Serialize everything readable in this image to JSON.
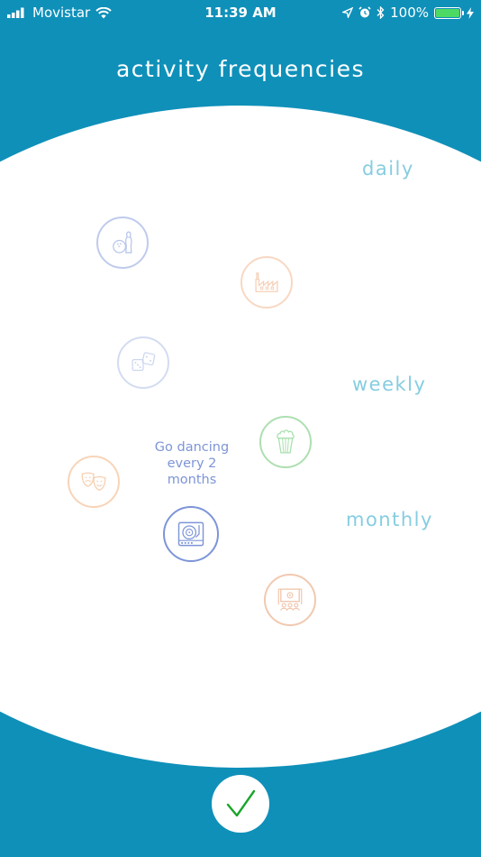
{
  "status_bar": {
    "carrier": "Movistar",
    "time": "11:39 AM",
    "battery_percent": "100%",
    "battery_level": 1.0
  },
  "title": "activity frequencies",
  "frequency_labels": {
    "daily": "daily",
    "weekly": "weekly",
    "monthly": "monthly"
  },
  "activities": [
    {
      "name": "bowling",
      "icon": "bowling-icon",
      "color": "#b8c6ea"
    },
    {
      "name": "factory",
      "icon": "factory-icon",
      "color": "#f6d0b8"
    },
    {
      "name": "dice",
      "icon": "dice-icon",
      "color": "#cdd7ef"
    },
    {
      "name": "popcorn",
      "icon": "popcorn-icon",
      "color": "#a9e1ae"
    },
    {
      "name": "theater",
      "icon": "theater-masks-icon",
      "color": "#f7cfae"
    },
    {
      "name": "dancing",
      "icon": "turntable-icon",
      "color": "#7d95d8",
      "selected": true
    },
    {
      "name": "cinema",
      "icon": "cinema-icon",
      "color": "#f0c3a8"
    }
  ],
  "selected_caption": "Go dancing every 2 months",
  "colors": {
    "background": "#0f90b9",
    "board": "#ffffff",
    "label": "#86cde0",
    "confirm_check": "#1aa52a"
  },
  "confirm_icon": "checkmark-icon"
}
